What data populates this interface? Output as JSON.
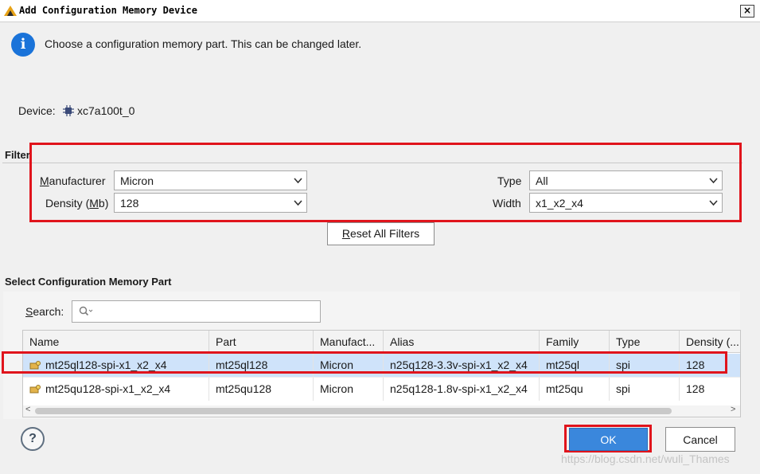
{
  "window": {
    "title": "Add Configuration Memory Device",
    "close_label": "×"
  },
  "info": {
    "message": "Choose a configuration memory part. This can be changed later."
  },
  "device": {
    "label": "Device:",
    "value": "xc7a100t_0"
  },
  "filter": {
    "section_label": "Filter",
    "manufacturer": {
      "label_key": "M",
      "label_rest": "anufacturer",
      "value": "Micron"
    },
    "density": {
      "label_pre": "Density (",
      "label_key": "M",
      "label_post": "b)",
      "value": "128"
    },
    "type": {
      "label": "Type",
      "value": "All"
    },
    "width": {
      "label": "Width",
      "value": "x1_x2_x4"
    },
    "reset": {
      "key": "R",
      "rest": "eset All Filters"
    }
  },
  "select": {
    "section_label": "Select Configuration Memory Part",
    "search": {
      "label_key": "S",
      "label_rest": "earch:",
      "placeholder": ""
    },
    "columns": [
      "Name",
      "Part",
      "Manufact...",
      "Alias",
      "Family",
      "Type",
      "Density (..."
    ],
    "rows": [
      {
        "name": "mt25ql128-spi-x1_x2_x4",
        "part": "mt25ql128",
        "manufacturer": "Micron",
        "alias": "n25q128-3.3v-spi-x1_x2_x4",
        "family": "mt25ql",
        "type": "spi",
        "density": "128",
        "selected": true
      },
      {
        "name": "mt25qu128-spi-x1_x2_x4",
        "part": "mt25qu128",
        "manufacturer": "Micron",
        "alias": "n25q128-1.8v-spi-x1_x2_x4",
        "family": "mt25qu",
        "type": "spi",
        "density": "128",
        "selected": false
      }
    ],
    "scroll_left": "<",
    "scroll_right": ">"
  },
  "footer": {
    "help_label": "?",
    "ok_label": "OK",
    "cancel_label": "Cancel",
    "watermark": "https://blog.csdn.net/wuli_Thames"
  },
  "colors": {
    "highlight_border": "#e0141c",
    "ok_button": "#3a87dc",
    "selected_row": "#cfe3fa",
    "info_icon": "#1a73d9"
  }
}
